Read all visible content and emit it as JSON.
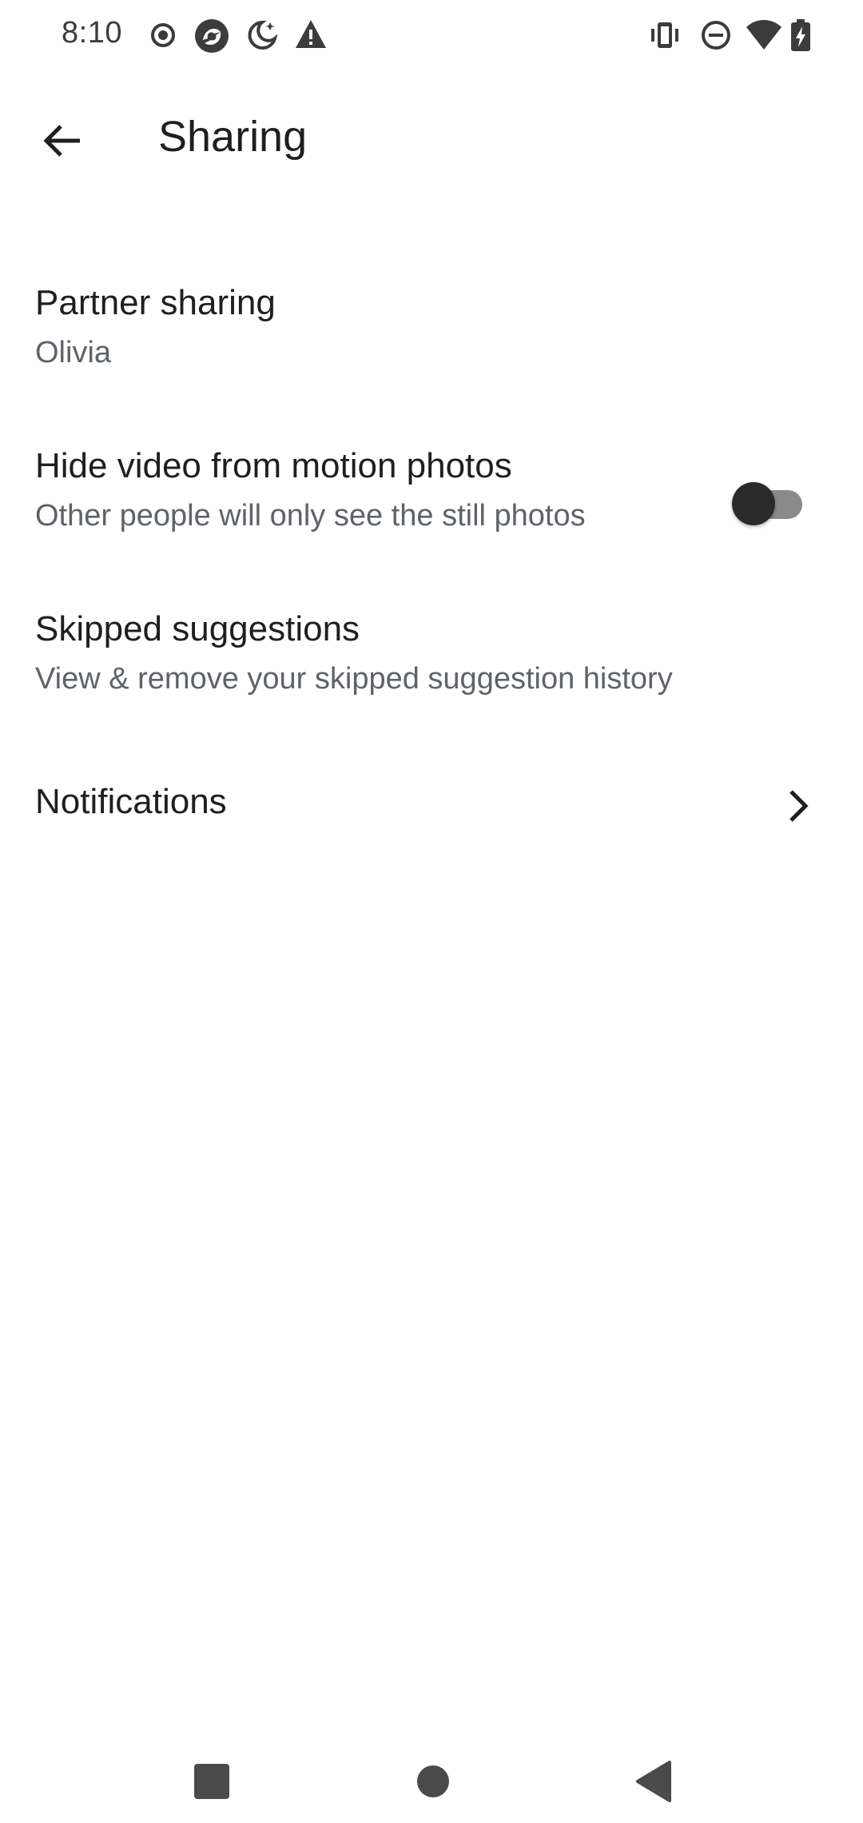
{
  "status_bar": {
    "time": "8:10",
    "left_icons": [
      "record-icon",
      "app-icon",
      "bedtime-icon",
      "warning-icon"
    ],
    "right_icons": [
      "vibrate-icon",
      "do-not-disturb-icon",
      "wifi-icon",
      "battery-charging-icon"
    ]
  },
  "app_bar": {
    "title": "Sharing",
    "back_icon": "arrow-back-icon"
  },
  "settings": {
    "partner_sharing": {
      "title": "Partner sharing",
      "subtitle": "Olivia"
    },
    "hide_video": {
      "title": "Hide video from motion photos",
      "subtitle": "Other people will only see the still photos",
      "toggle_on": false
    },
    "skipped_suggestions": {
      "title": "Skipped suggestions",
      "subtitle": "View & remove your skipped suggestion history"
    },
    "notifications": {
      "title": "Notifications",
      "icon": "chevron-right-icon"
    }
  },
  "nav_bar": {
    "buttons": [
      "recents-button",
      "home-button",
      "back-button"
    ]
  },
  "colors": {
    "background": "#ffffff",
    "title_text": "#1f1f1f",
    "subtitle_text": "#5f6368",
    "toggle_track": "#8a8a8a",
    "toggle_thumb": "#2a2a2a"
  }
}
